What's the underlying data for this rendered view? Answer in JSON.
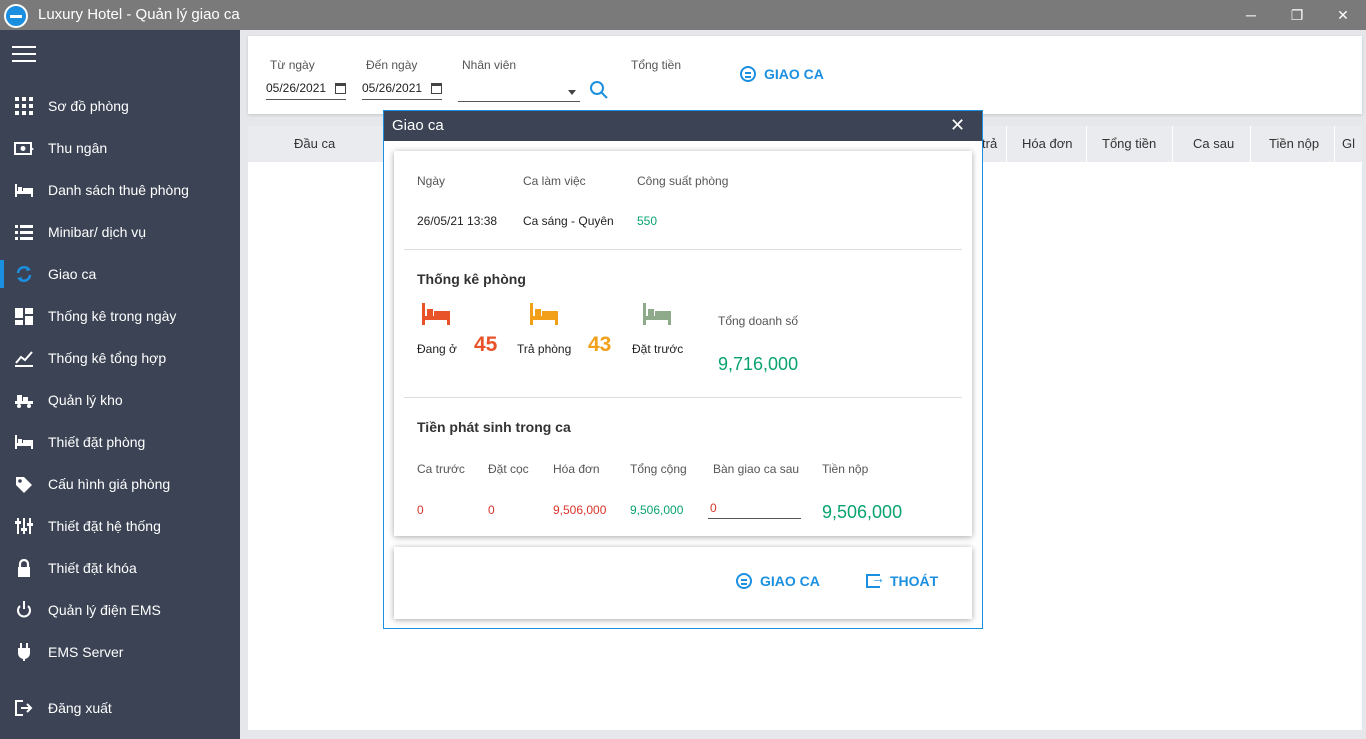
{
  "window": {
    "title": "Luxury Hotel - Quản lý giao ca",
    "minimize": "─",
    "restore": "❐",
    "close": "✕"
  },
  "sidebar": {
    "items": [
      {
        "label": "Sơ đồ phòng",
        "icon": "grid-icon"
      },
      {
        "label": "Thu ngân",
        "icon": "cash-icon"
      },
      {
        "label": "Danh sách thuê phòng",
        "icon": "bed-icon"
      },
      {
        "label": "Minibar/ dịch vụ",
        "icon": "list-icon"
      },
      {
        "label": "Giao ca",
        "icon": "refresh-icon",
        "active": true
      },
      {
        "label": "Thống kê trong ngày",
        "icon": "dashboard-icon"
      },
      {
        "label": "Thống kê tổng hợp",
        "icon": "chart-icon"
      },
      {
        "label": "Quản lý kho",
        "icon": "warehouse-icon"
      },
      {
        "label": "Thiết đặt phòng",
        "icon": "room-icon"
      },
      {
        "label": "Cấu hình giá phòng",
        "icon": "tag-icon"
      },
      {
        "label": "Thiết đặt hệ thống",
        "icon": "sliders-icon"
      },
      {
        "label": "Thiết đặt khóa",
        "icon": "lock-icon"
      },
      {
        "label": "Quản lý điện EMS",
        "icon": "power-icon"
      },
      {
        "label": "EMS Server",
        "icon": "plug-icon"
      },
      {
        "label": "Đăng xuất",
        "icon": "logout-icon"
      }
    ]
  },
  "filters": {
    "from_label": "Từ ngày",
    "from_value": "05/26/2021",
    "to_label": "Đến ngày",
    "to_value": "05/26/2021",
    "staff_label": "Nhân viên",
    "staff_value": "",
    "total_label": "Tổng tiền",
    "giaoca_button": "GIAO CA"
  },
  "grid": {
    "columns": [
      "Đầu ca",
      "trả",
      "Hóa đơn",
      "Tổng tiền",
      "Ca sau",
      "Tiền nộp",
      "Gl"
    ]
  },
  "modal": {
    "title": "Giao ca",
    "close": "✕",
    "info": {
      "date_label": "Ngày",
      "date_value": "26/05/21 13:38",
      "shift_label": "Ca làm việc",
      "shift_value": "Ca sáng - Quyên",
      "capacity_label": "Công suất phòng",
      "capacity_value": "550"
    },
    "room_stats": {
      "title": "Thống kê phòng",
      "occupied_label": "Đang ở",
      "occupied_value": "45",
      "checkout_label": "Trả phòng",
      "checkout_value": "43",
      "reserved_label": "Đặt trước",
      "total_sales_label": "Tổng doanh số",
      "total_sales_value": "9,716,000"
    },
    "money": {
      "title": "Tiền phát sinh trong ca",
      "prev_shift_label": "Ca trước",
      "prev_shift_value": "0",
      "deposit_label": "Đặt cọc",
      "deposit_value": "0",
      "invoice_label": "Hóa đơn",
      "invoice_value": "9,506,000",
      "total_label": "Tổng cộng",
      "total_value": "9,506,000",
      "handover_label": "Bàn giao ca sau",
      "handover_value": "0",
      "submit_label": "Tiền nộp",
      "submit_value": "9,506,000"
    },
    "buttons": {
      "giaoca": "GIAO CA",
      "exit": "THOÁT"
    }
  },
  "colors": {
    "sidebar_bg": "#3b4354",
    "accent": "#1b8fe0",
    "green": "#0aa370",
    "red": "#d9342b",
    "orange": "#e8532a",
    "amber": "#f2a01a"
  }
}
